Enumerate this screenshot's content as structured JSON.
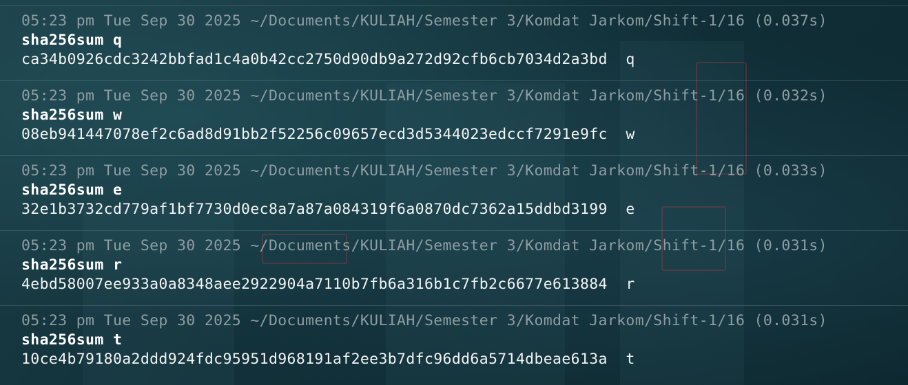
{
  "terminal": {
    "entries": [
      {
        "prompt": "05:23 pm Tue Sep 30 2025 ~/Documents/KULIAH/Semester 3/Komdat Jarkom/Shift-1/16 (0.037s)",
        "command": "sha256sum q",
        "hash": "ca34b0926cdc3242bbfad1c4a0b42cc2750d90db9a272d92cfb6cb7034d2a3bd",
        "file": "q"
      },
      {
        "prompt": "05:23 pm Tue Sep 30 2025 ~/Documents/KULIAH/Semester 3/Komdat Jarkom/Shift-1/16 (0.032s)",
        "command": "sha256sum w",
        "hash": "08eb941447078ef2c6ad8d91bb2f52256c09657ecd3d5344023edccf7291e9fc",
        "file": "w"
      },
      {
        "prompt": "05:23 pm Tue Sep 30 2025 ~/Documents/KULIAH/Semester 3/Komdat Jarkom/Shift-1/16 (0.033s)",
        "command": "sha256sum e",
        "hash": "32e1b3732cd779af1bf7730d0ec8a7a87a084319f6a0870dc7362a15ddbd3199",
        "file": "e"
      },
      {
        "prompt": "05:23 pm Tue Sep 30 2025 ~/Documents/KULIAH/Semester 3/Komdat Jarkom/Shift-1/16 (0.031s)",
        "command": "sha256sum r",
        "hash": "4ebd58007ee933a0a8348aee2922904a7110b7fb6a316b1c7fb2c6677e613884",
        "file": "r"
      },
      {
        "prompt": "05:23 pm Tue Sep 30 2025 ~/Documents/KULIAH/Semester 3/Komdat Jarkom/Shift-1/16 (0.031s)",
        "command": "sha256sum t",
        "hash": "10ce4b79180a2ddd924fdc95951d968191af2ee3b7dfc96dd6a5714dbeae613a",
        "file": "t"
      }
    ]
  },
  "colors": {
    "prompt": "#8e9da1",
    "command": "#ffffff",
    "output": "#f2f4f4",
    "background": "#0f2a33"
  }
}
